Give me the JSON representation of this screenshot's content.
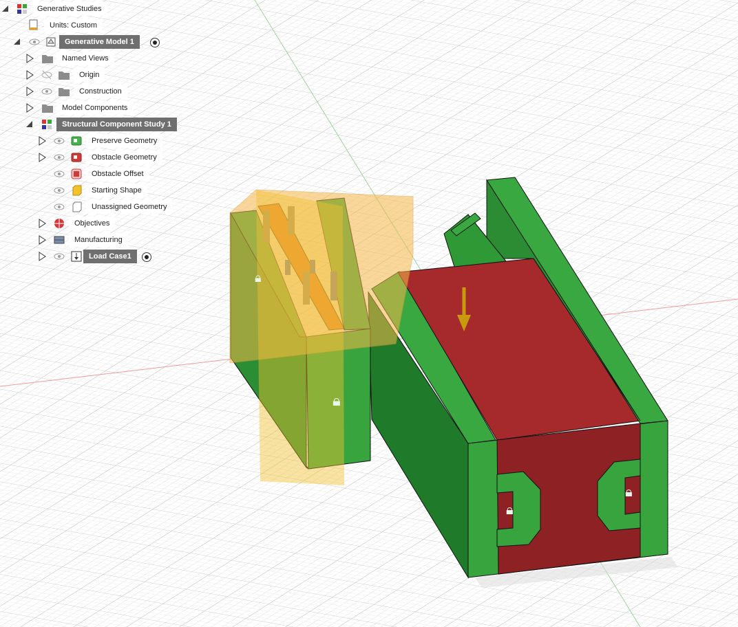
{
  "browser": {
    "root_label": "Generative Studies",
    "units_label": "Units: Custom",
    "model_label": "Generative Model 1",
    "named_views_label": "Named Views",
    "origin_label": "Origin",
    "construction_label": "Construction",
    "model_components_label": "Model Components",
    "study_label": "Structural Component Study 1",
    "preserve_label": "Preserve Geometry",
    "obstacle_label": "Obstacle Geometry",
    "obstacle_offset_label": "Obstacle Offset",
    "starting_shape_label": "Starting Shape",
    "unassigned_label": "Unassigned Geometry",
    "objectives_label": "Objectives",
    "manufacturing_label": "Manufacturing",
    "load_case_label": "Load Case1"
  },
  "colors": {
    "preserve": "#33a83a",
    "obstacle": "#a3282a",
    "starting_shape": "#f0c020",
    "load_arrow": "#c89a10",
    "grid_line": "#d8d8d8",
    "axis_red": "#ff8080",
    "axis_green": "#80d080"
  },
  "icons": {
    "eye": "eye-icon",
    "eye_hidden": "eye-hidden-icon",
    "folder": "folder-icon",
    "expand": "expand-arrow-icon",
    "collapse": "collapse-arrow-icon",
    "radio": "active-radio-icon"
  }
}
